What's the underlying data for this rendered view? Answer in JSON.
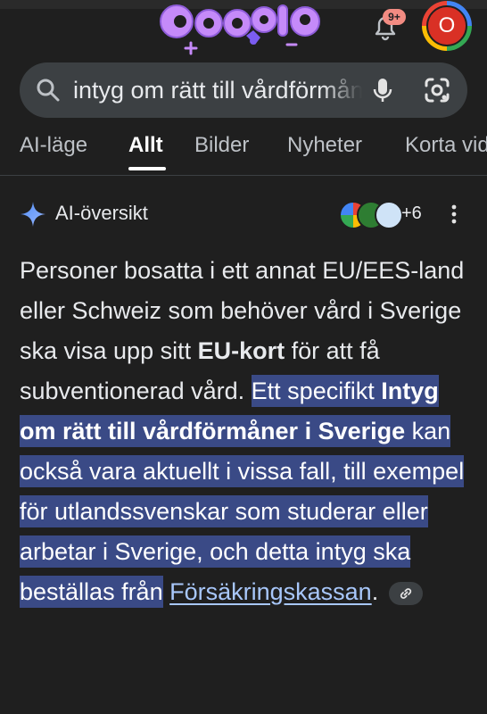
{
  "header": {
    "notification_badge": "9+",
    "avatar_initial": "O"
  },
  "search": {
    "query": "intyg om rätt till vårdförmåner i Sverige"
  },
  "tabs": [
    {
      "label": "AI-läge"
    },
    {
      "label": "Allt",
      "active": true
    },
    {
      "label": "Bilder"
    },
    {
      "label": "Nyheter"
    },
    {
      "label": "Korta videor"
    }
  ],
  "ai_overview": {
    "title": "AI-översikt",
    "more_sources": "+6",
    "answer": {
      "s1": "Personer bosatta i ett annat EU/EES-land eller Schweiz som behöver vård i Sverige ska visa upp sitt ",
      "s1_bold": "EU-kort",
      "s2": " för att få subventionerad vård. ",
      "h1": "Ett specifikt ",
      "h1_bold": "Intyg om rätt till vårdförmåner i Sverige",
      "h2": " kan också vara aktuellt i vissa fall, till exempel för utlandssvenskar som studerar eller arbetar i Sverige, och detta intyg ska beställas från",
      "link": "Försäkringskassan",
      "end": "."
    }
  },
  "colors": {
    "background": "#1f1f1f",
    "search_bg": "#3c4043",
    "highlight": "#3a4a86",
    "link": "#a8c7fa",
    "badge": "#f28b82",
    "avatar": "#d93025"
  }
}
